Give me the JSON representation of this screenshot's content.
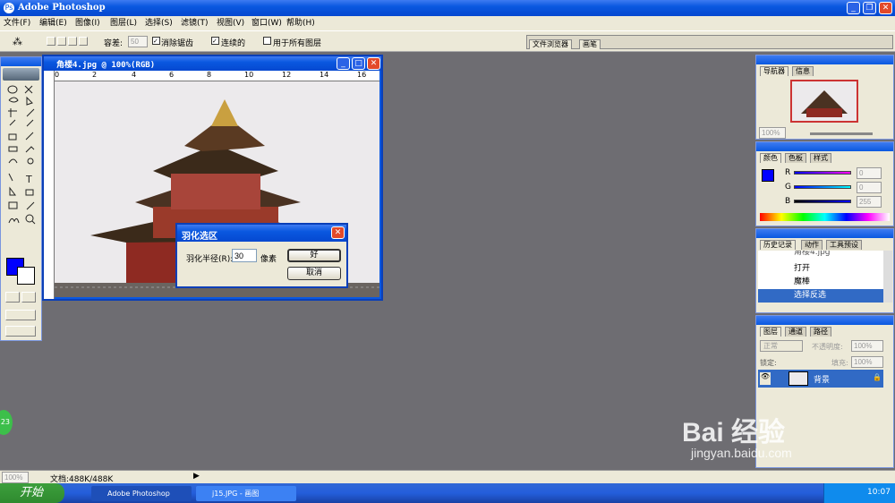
{
  "app": {
    "title": "Adobe Photoshop"
  },
  "menu": [
    "文件(F)",
    "编辑(E)",
    "图像(I)",
    "图层(L)",
    "选择(S)",
    "滤镜(T)",
    "视图(V)",
    "窗口(W)",
    "帮助(H)"
  ],
  "options": {
    "tolerance_label": "容差:",
    "tolerance_value": "50",
    "antialias": "消除锯齿",
    "contiguous": "连续的",
    "all_layers": "用于所有图层",
    "tabs": [
      "文件浏览器",
      "画笔"
    ]
  },
  "document": {
    "title": "角楼4.jpg @ 100%(RGB)",
    "ruler": [
      "0",
      "2",
      "4",
      "6",
      "8",
      "10",
      "12",
      "14",
      "16"
    ],
    "colors": {
      "background": "#eceaec",
      "wall": "#8e2a22",
      "roof": "#3b2a1a"
    }
  },
  "feather": {
    "title": "羽化选区",
    "label": "羽化半径(R):",
    "value": "30",
    "unit": "像素",
    "ok": "好",
    "cancel": "取消"
  },
  "navigator": {
    "tabs": [
      "导航器",
      "信息"
    ],
    "zoom": "100%"
  },
  "color": {
    "tabs": [
      "颜色",
      "色板",
      "样式"
    ],
    "labels": [
      "R",
      "G",
      "B"
    ],
    "values": [
      "0",
      "0",
      "255"
    ],
    "foreground": "#0000ff"
  },
  "history": {
    "tabs": [
      "历史记录",
      "动作",
      "工具预设"
    ],
    "items": [
      "角楼4.jpg",
      "打开",
      "魔棒",
      "选择反选"
    ]
  },
  "layers": {
    "tabs": [
      "图层",
      "通道",
      "路径"
    ],
    "blend": "正常",
    "opacity_label": "不透明度:",
    "opacity": "100%",
    "lock_label": "锁定:",
    "fill_label": "填充:",
    "fill": "100%",
    "layer_name": "背景"
  },
  "status": {
    "zoom": "100%",
    "doc": "文档:488K/488K"
  },
  "taskbar": {
    "start": "开始",
    "tasks": [
      "Adobe Photoshop",
      "j15.JPG - 画图"
    ],
    "time": "10:07",
    "badge": "23"
  },
  "watermark": {
    "text": "Bai 经验",
    "url": "jingyan.baidu.com"
  }
}
